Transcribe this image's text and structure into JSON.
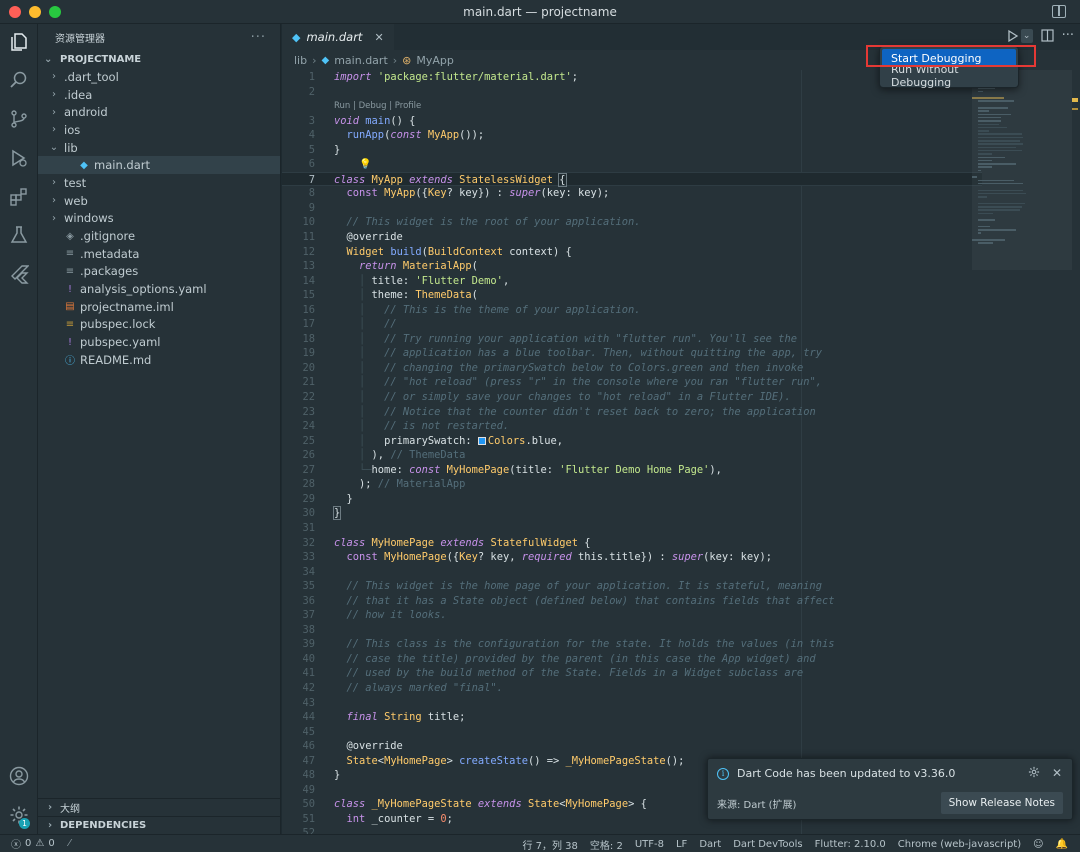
{
  "window": {
    "title": "main.dart — projectname"
  },
  "activity": {
    "icons": [
      "files-icon",
      "search-icon",
      "source-control-icon",
      "run-debug-icon",
      "extensions-icon",
      "testing-icon",
      "flutter-icon",
      "account-icon",
      "settings-gear-icon"
    ],
    "settings_badge": "1"
  },
  "sidebar": {
    "header": "资源管理器",
    "more": "···",
    "project": "PROJECTNAME",
    "items": [
      {
        "label": ".dart_tool",
        "type": "folder"
      },
      {
        "label": ".idea",
        "type": "folder"
      },
      {
        "label": "android",
        "type": "folder"
      },
      {
        "label": "ios",
        "type": "folder"
      },
      {
        "label": "lib",
        "type": "folder-open"
      },
      {
        "label": "main.dart",
        "type": "dart-file"
      },
      {
        "label": "test",
        "type": "folder"
      },
      {
        "label": "web",
        "type": "folder"
      },
      {
        "label": "windows",
        "type": "folder"
      },
      {
        "label": ".gitignore",
        "type": "git-file"
      },
      {
        "label": ".metadata",
        "type": "text-file"
      },
      {
        "label": ".packages",
        "type": "text-file"
      },
      {
        "label": "analysis_options.yaml",
        "type": "yaml-file"
      },
      {
        "label": "projectname.iml",
        "type": "iml-file"
      },
      {
        "label": "pubspec.lock",
        "type": "lock-file"
      },
      {
        "label": "pubspec.yaml",
        "type": "yaml-file"
      },
      {
        "label": "README.md",
        "type": "info-file"
      }
    ],
    "outline": "大纲",
    "dependencies": "DEPENDENCIES"
  },
  "editor": {
    "tab": {
      "label": "main.dart",
      "close": "✕"
    },
    "breadcrumb": {
      "folder": "lib",
      "file": "main.dart",
      "symbol": "MyApp"
    },
    "codelens": "Run | Debug | Profile",
    "more": "···"
  },
  "run_menu": {
    "items": [
      "Start Debugging",
      "Run Without Debugging"
    ]
  },
  "notification": {
    "message": "Dart Code has been updated to v3.36.0",
    "source": "来源: Dart (扩展)",
    "button": "Show Release Notes"
  },
  "statusbar": {
    "errors": "0",
    "warnings": "0",
    "position": "行 7，列 38",
    "spaces": "空格: 2",
    "encoding": "UTF-8",
    "eol": "LF",
    "language": "Dart",
    "devtools": "Dart DevTools",
    "flutter": "Flutter: 2.10.0",
    "device": "Chrome (web-javascript)"
  },
  "colors": {
    "bg": "#263238",
    "accent": "#0e64c2",
    "highlight_box": "#e53935"
  }
}
